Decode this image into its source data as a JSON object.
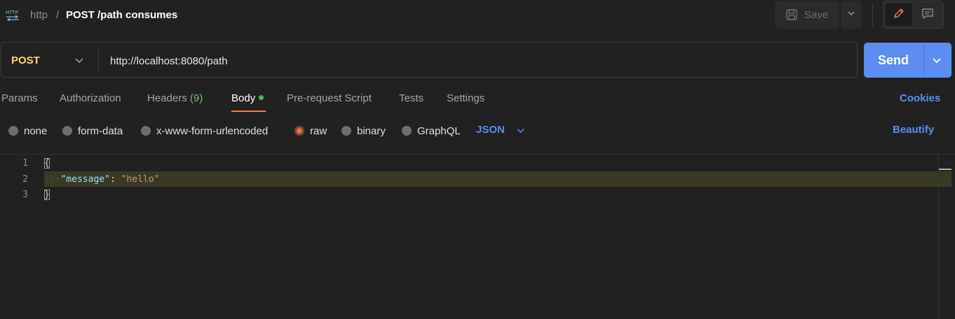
{
  "header": {
    "collection": "http",
    "separator": "/",
    "request_name": "POST /path consumes",
    "save_label": "Save"
  },
  "request": {
    "method": "POST",
    "url": "http://localhost:8080/path",
    "send_label": "Send"
  },
  "tabs": [
    {
      "label": "Params"
    },
    {
      "label": "Authorization"
    },
    {
      "label": "Headers",
      "count": "(9)"
    },
    {
      "label": "Body",
      "active": true
    },
    {
      "label": "Pre-request Script"
    },
    {
      "label": "Tests"
    },
    {
      "label": "Settings"
    }
  ],
  "cookies_label": "Cookies",
  "body_types": [
    {
      "label": "none"
    },
    {
      "label": "form-data"
    },
    {
      "label": "x-www-form-urlencoded"
    },
    {
      "label": "raw",
      "selected": true
    },
    {
      "label": "binary"
    },
    {
      "label": "GraphQL"
    }
  ],
  "language": "JSON",
  "beautify_label": "Beautify",
  "editor": {
    "line_numbers": [
      "1",
      "2",
      "3"
    ],
    "open_brace": "{",
    "key": "\"message\"",
    "colon": ": ",
    "value": "\"hello\"",
    "close_brace": "}"
  },
  "colors": {
    "accent": "#5b8ef0",
    "method": "#ffd76d",
    "active_tab_underline": "#f07a4b",
    "body_dot": "#4fb45c"
  }
}
